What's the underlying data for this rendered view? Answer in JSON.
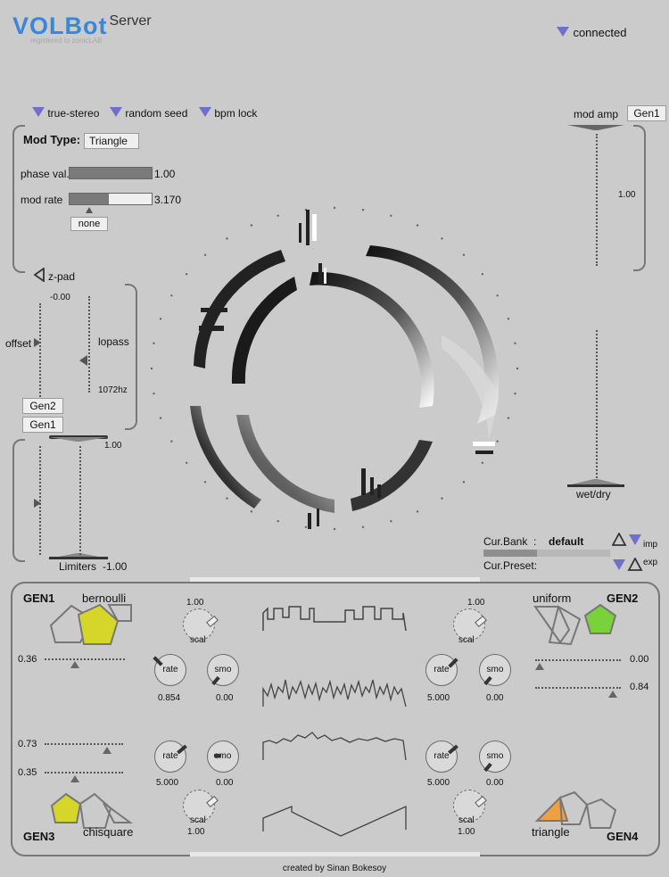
{
  "header": {
    "logo_main": "VOLBot",
    "logo_server": "Server",
    "logo_sub": "registered to zonicLAB",
    "status": "connected"
  },
  "options": {
    "true_stereo": "true-stereo",
    "random_seed": "random seed",
    "bpm_lock": "bpm lock"
  },
  "mod": {
    "type_label": "Mod Type:",
    "type_value": "Triangle",
    "phase_label": "phase val.",
    "phase_value": "1.00",
    "phase_fraction": 1.0,
    "rate_label": "mod rate",
    "rate_value": "3.170",
    "rate_fraction": 0.48,
    "none_label": "none"
  },
  "zpad": {
    "label": "z-pad",
    "top_value": "-0.00",
    "offset_label": "offset",
    "lopass_label": "lopass",
    "lopass_value": "1072hz",
    "gen2": "Gen2",
    "gen1": "Gen1"
  },
  "limiters": {
    "top_value": "1.00",
    "label": "Limiters",
    "bottom_value": "-1.00"
  },
  "right": {
    "mod_amp_label": "mod amp",
    "gen_select": "Gen1",
    "amp_value": "1.00",
    "wet_dry_label": "wet/dry"
  },
  "bank": {
    "bank_label": "Cur.Bank",
    "bank_sep": ":",
    "bank_value": "default",
    "preset_label": "Cur.Preset:",
    "imp": "imp",
    "exp": "exp"
  },
  "gens": {
    "gen1": {
      "name": "GEN1",
      "dist": "bernoulli",
      "scal": "1.00",
      "rate": "0.854",
      "smo": "0.00",
      "slider": "0.36"
    },
    "gen2": {
      "name": "GEN2",
      "dist": "uniform",
      "scal": "1.00",
      "rate": "5.000",
      "smo": "0.00",
      "slider1": "0.00",
      "slider2": "0.84"
    },
    "gen3": {
      "name": "GEN3",
      "dist": "chisquare",
      "scal": "1.00",
      "rate": "5.000",
      "smo": "0.00",
      "slider1": "0.73",
      "slider2": "0.35"
    },
    "gen4": {
      "name": "GEN4",
      "dist": "triangle",
      "scal": "1.00",
      "rate": "5.000",
      "smo": "0.00"
    }
  },
  "knob_labels": {
    "scal": "scal",
    "rate": "rate",
    "smo": "smo"
  },
  "colors": {
    "accent": "#6f6fcc",
    "logo": "#3a86d8",
    "yellow": "#d6d62a",
    "green": "#7ad23a",
    "orange": "#f0a040",
    "background": "#cbcbcb"
  },
  "footer": "created by Sinan Bokesoy"
}
